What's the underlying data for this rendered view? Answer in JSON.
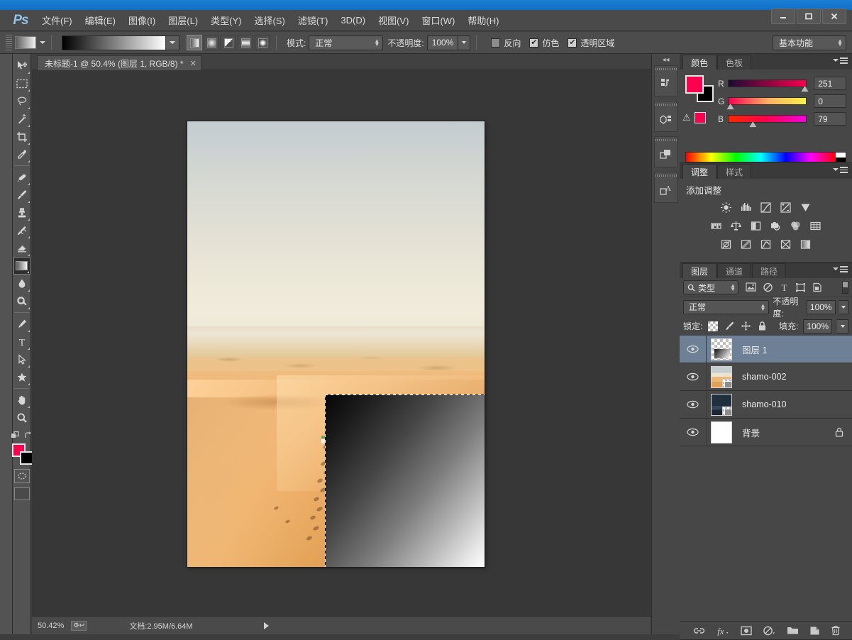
{
  "window": {
    "minimize_label": "—",
    "maximize_label": "❐",
    "close_label": "✕"
  },
  "app": {
    "logo": "Ps"
  },
  "menubar": {
    "items": [
      {
        "label": "文件(F)"
      },
      {
        "label": "编辑(E)"
      },
      {
        "label": "图像(I)"
      },
      {
        "label": "图层(L)"
      },
      {
        "label": "类型(Y)"
      },
      {
        "label": "选择(S)"
      },
      {
        "label": "滤镜(T)"
      },
      {
        "label": "3D(D)"
      },
      {
        "label": "视图(V)"
      },
      {
        "label": "窗口(W)"
      },
      {
        "label": "帮助(H)"
      }
    ]
  },
  "options_bar": {
    "mode_label": "模式:",
    "mode_value": "正常",
    "opacity_label": "不透明度:",
    "opacity_value": "100%",
    "reverse_label": "反向",
    "reverse_checked": false,
    "dither_label": "仿色",
    "dither_checked": true,
    "transparency_label": "透明区域",
    "transparency_checked": true,
    "workspace_value": "基本功能",
    "gradient_types": [
      "线性渐变",
      "径向渐变",
      "角度渐变",
      "对称渐变",
      "菱形渐变"
    ],
    "gradient_type_active": 0
  },
  "toolbar": {
    "tools": [
      {
        "name": "move-tool",
        "title": "移动工具"
      },
      {
        "name": "marquee-tool",
        "title": "矩形选框工具"
      },
      {
        "name": "lasso-tool",
        "title": "套索工具"
      },
      {
        "name": "magic-wand-tool",
        "title": "魔棒工具"
      },
      {
        "name": "crop-tool",
        "title": "裁剪工具"
      },
      {
        "name": "eyedropper-tool",
        "title": "吸管工具"
      },
      {
        "name": "healing-brush-tool",
        "title": "污点修复画笔工具"
      },
      {
        "name": "brush-tool",
        "title": "画笔工具"
      },
      {
        "name": "clone-stamp-tool",
        "title": "仿制图章工具"
      },
      {
        "name": "history-brush-tool",
        "title": "历史记录画笔工具"
      },
      {
        "name": "eraser-tool",
        "title": "橡皮擦工具"
      },
      {
        "name": "gradient-tool",
        "title": "渐变工具"
      },
      {
        "name": "blur-tool",
        "title": "模糊工具"
      },
      {
        "name": "dodge-tool",
        "title": "减淡工具"
      },
      {
        "name": "pen-tool",
        "title": "钢笔工具"
      },
      {
        "name": "type-tool",
        "title": "横排文字工具"
      },
      {
        "name": "path-selection-tool",
        "title": "路径选择工具"
      },
      {
        "name": "shape-tool",
        "title": "自定形状工具"
      },
      {
        "name": "hand-tool",
        "title": "抓手工具"
      },
      {
        "name": "zoom-tool",
        "title": "缩放工具"
      }
    ],
    "active_tool": "gradient-tool",
    "foreground_color": "#fb004f",
    "background_color": "#000000"
  },
  "document": {
    "tab_title": "未标题-1 @ 50.4% (图层 1, RGB/8) *",
    "tab_close": "✕"
  },
  "status_bar": {
    "zoom": "50.42%",
    "doc_info": "文档:2.95M/6.64M"
  },
  "color_panel": {
    "tabs": [
      {
        "label": "颜色",
        "active": true
      },
      {
        "label": "色板",
        "active": false
      }
    ],
    "channels": [
      {
        "label": "R",
        "value": "251",
        "pos": 98
      },
      {
        "label": "G",
        "value": "0",
        "pos": 0
      },
      {
        "label": "B",
        "value": "79",
        "pos": 31
      }
    ],
    "foreground": "#fb004f",
    "background": "#000000",
    "warning_icon": "gamut-warning",
    "warning_color": "#fb004f"
  },
  "adjustments_panel": {
    "tabs": [
      {
        "label": "调整",
        "active": true
      },
      {
        "label": "样式",
        "active": false
      }
    ],
    "title": "添加调整",
    "rows": [
      [
        "brightness-contrast-icon",
        "levels-icon",
        "curves-icon",
        "exposure-icon",
        "vibrance-icon"
      ],
      [
        "hue-saturation-icon",
        "color-balance-icon",
        "black-white-icon",
        "photo-filter-icon",
        "channel-mixer-icon",
        "color-lookup-icon"
      ],
      [
        "invert-icon",
        "posterize-icon",
        "threshold-icon",
        "gradient-map-icon",
        "selective-color-icon"
      ]
    ]
  },
  "layers_panel": {
    "tabs": [
      {
        "label": "图层",
        "active": true
      },
      {
        "label": "通道",
        "active": false
      },
      {
        "label": "路径",
        "active": false
      }
    ],
    "filter_value": "类型",
    "filter_icons": [
      "pixel-filter-icon",
      "adjustment-filter-icon",
      "type-filter-icon",
      "shape-filter-icon",
      "smartobject-filter-icon"
    ],
    "blend_mode": "正常",
    "opacity_label": "不透明度:",
    "opacity_value": "100%",
    "lock_label": "锁定:",
    "lock_icons": [
      "lock-transparency-icon",
      "lock-image-icon",
      "lock-position-icon",
      "lock-all-icon"
    ],
    "fill_label": "填充:",
    "fill_value": "100%",
    "layers": [
      {
        "name": "图层 1",
        "selected": true,
        "visible": true,
        "thumb": "gradient-transparent",
        "locked": false
      },
      {
        "name": "shamo-002",
        "selected": false,
        "visible": true,
        "thumb": "desert",
        "locked": false
      },
      {
        "name": "shamo-010",
        "selected": false,
        "visible": true,
        "thumb": "night",
        "locked": false
      },
      {
        "name": "背景",
        "selected": false,
        "visible": true,
        "thumb": "white",
        "locked": true
      }
    ],
    "footer_buttons": [
      "link-layers-icon",
      "layer-style-icon",
      "layer-mask-icon",
      "new-adjustment-icon",
      "new-group-icon",
      "new-layer-icon",
      "delete-layer-icon"
    ]
  },
  "mini_dock": {
    "collapse_label": "◂◂",
    "icons": [
      "history-panel-icon",
      "mini-bridge-icon",
      "layer-comps-icon",
      "character-styles-icon"
    ]
  },
  "canvas": {
    "zoom_percent": "50.4%",
    "selection_active": true,
    "gradient_description": "linear black to white diagonal"
  }
}
